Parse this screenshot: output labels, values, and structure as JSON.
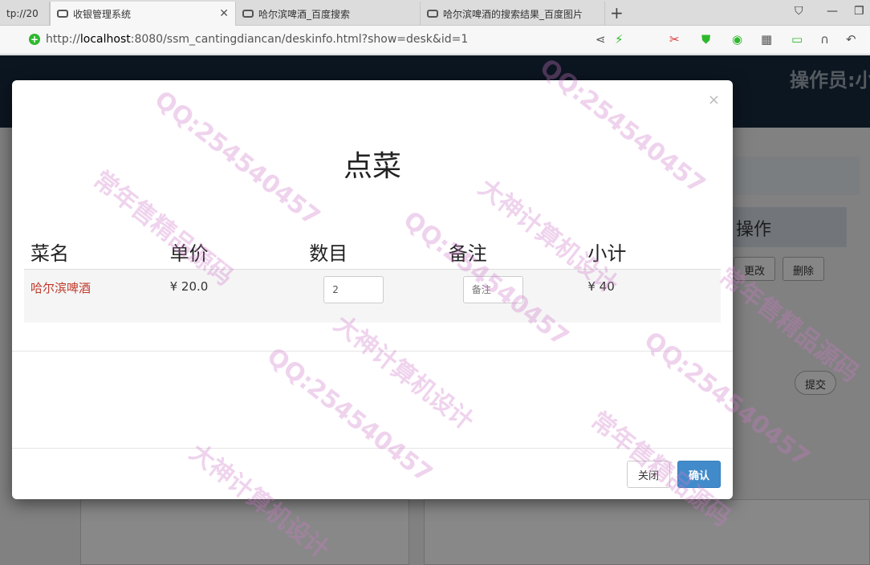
{
  "browser": {
    "tabs": [
      {
        "label": "tp://20",
        "active": false
      },
      {
        "label": "收银管理系统",
        "active": true
      },
      {
        "label": "哈尔滨啤酒_百度搜索",
        "active": false
      },
      {
        "label": "哈尔滨啤酒的搜索结果_百度图片",
        "active": false
      }
    ],
    "new_tab": "+",
    "url_host": "localhost",
    "url_prefix": "http://",
    "url_rest": ":8080/ssm_cantingdiancan/deskinfo.html?show=desk&id=1"
  },
  "app": {
    "operator_label": "操作员:小",
    "ops_header": "操作",
    "edit_label": "更改",
    "delete_label": "删除",
    "submit_label": "提交"
  },
  "modal": {
    "title": "点菜",
    "columns": [
      "菜名",
      "单价",
      "数目",
      "备注",
      "小计"
    ],
    "rows": [
      {
        "name": "哈尔滨啤酒",
        "price": "¥ 20.0",
        "quantity": "2",
        "remark_placeholder": "备注",
        "subtotal": "¥ 40"
      }
    ],
    "close_label": "关闭",
    "confirm_label": "确认"
  },
  "watermark": {
    "qq": "QQ:254540457",
    "t1": "大神计算机设计",
    "t2": "常年售精品源码"
  }
}
